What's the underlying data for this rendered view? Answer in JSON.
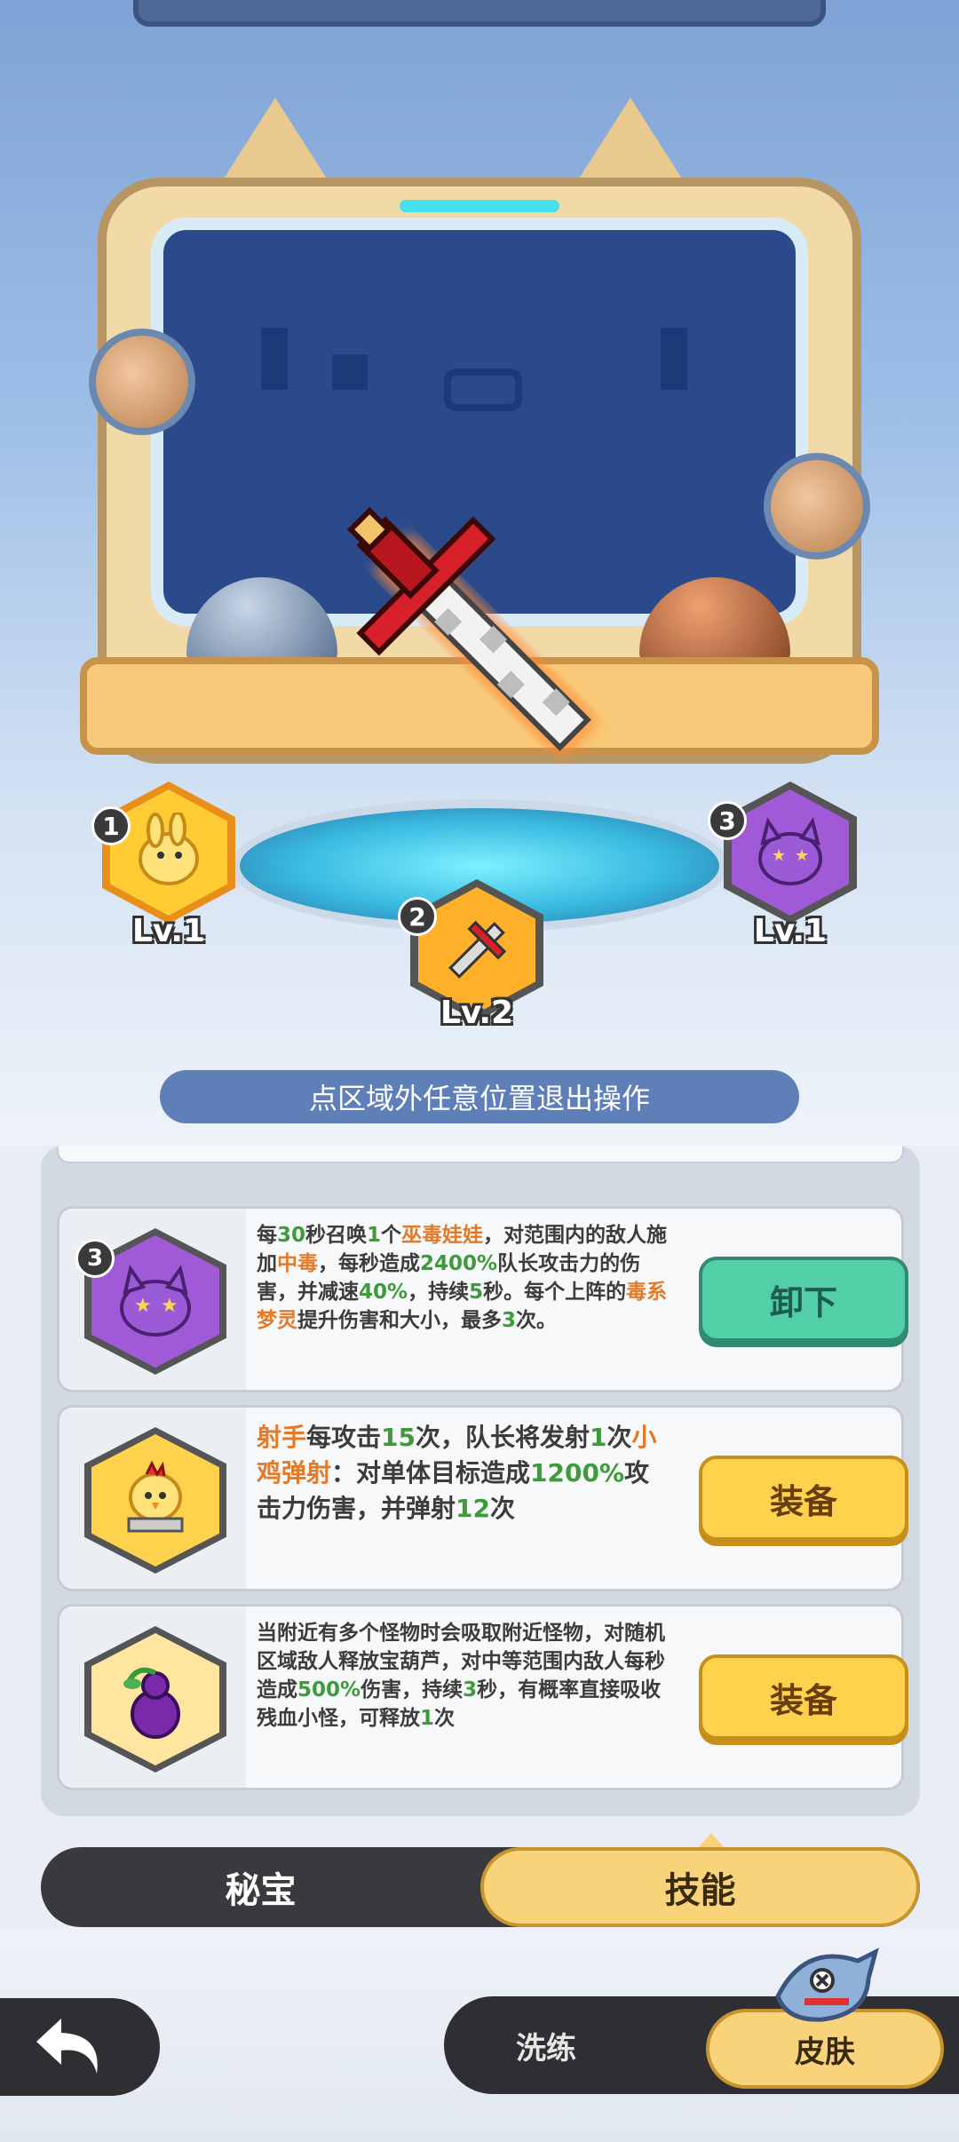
{
  "scene": {
    "featured_item_icon": "pixel-sword-icon",
    "slots": [
      {
        "number": "1",
        "level": "Lv.1",
        "icon": "chick-pet-icon",
        "color": "#ffcc33"
      },
      {
        "number": "2",
        "level": "Lv.2",
        "icon": "sword-icon",
        "color": "#ff8a2a"
      },
      {
        "number": "3",
        "level": "Lv.1",
        "icon": "purple-spirit-icon",
        "color": "#a05ad8"
      }
    ],
    "hint": "点区域外任意位置退出操作"
  },
  "skills": [
    {
      "number": "3",
      "icon": "poison-spirit-icon",
      "desc_html_parts": [
        {
          "t": "每",
          "c": ""
        },
        {
          "t": "30",
          "c": "g"
        },
        {
          "t": "秒召唤",
          "c": ""
        },
        {
          "t": "1",
          "c": "g"
        },
        {
          "t": "个",
          "c": ""
        },
        {
          "t": "巫毒娃娃",
          "c": "o"
        },
        {
          "t": "，对范围内的敌人施加",
          "c": ""
        },
        {
          "t": "中毒",
          "c": "o"
        },
        {
          "t": "，每秒造成",
          "c": ""
        },
        {
          "t": "2400%",
          "c": "g"
        },
        {
          "t": "队长攻击力的伤害，并减速",
          "c": ""
        },
        {
          "t": "40%",
          "c": "g"
        },
        {
          "t": "，持续",
          "c": ""
        },
        {
          "t": "5",
          "c": "g"
        },
        {
          "t": "秒。每个上阵的",
          "c": ""
        },
        {
          "t": "毒系梦灵",
          "c": "o"
        },
        {
          "t": "提升伤害和大小，最多",
          "c": ""
        },
        {
          "t": "3",
          "c": "g"
        },
        {
          "t": "次。",
          "c": ""
        }
      ],
      "button": "卸下",
      "button_type": "unequip"
    },
    {
      "number": "",
      "icon": "chick-missile-icon",
      "desc_html_parts": [
        {
          "t": "射手",
          "c": "o"
        },
        {
          "t": "每攻击",
          "c": ""
        },
        {
          "t": "15",
          "c": "g"
        },
        {
          "t": "次，队长将发射",
          "c": ""
        },
        {
          "t": "1",
          "c": "g"
        },
        {
          "t": "次",
          "c": ""
        },
        {
          "t": "小鸡弹射",
          "c": "o"
        },
        {
          "t": "：对单体目标造成",
          "c": ""
        },
        {
          "t": "1200%",
          "c": "g"
        },
        {
          "t": "攻击力伤害，并弹射",
          "c": ""
        },
        {
          "t": "12",
          "c": "g"
        },
        {
          "t": "次",
          "c": ""
        }
      ],
      "button": "装备",
      "button_type": "equip",
      "big": true
    },
    {
      "number": "",
      "icon": "treasure-gourd-icon",
      "desc_html_parts": [
        {
          "t": "当附近有多个怪物时会吸取附近怪物，对随机区域敌人释放宝葫芦，对中等范围内敌人每秒造成",
          "c": ""
        },
        {
          "t": "500%",
          "c": "g"
        },
        {
          "t": "伤害，持续",
          "c": ""
        },
        {
          "t": "3",
          "c": "g"
        },
        {
          "t": "秒，有概率直接吸收残血小怪，可释放",
          "c": ""
        },
        {
          "t": "1",
          "c": "g"
        },
        {
          "t": "次",
          "c": ""
        }
      ],
      "button": "装备",
      "button_type": "equip"
    }
  ],
  "tabs": {
    "treasure": "秘宝",
    "skill": "技能",
    "active": "skill"
  },
  "bottom": {
    "refine": "洗练",
    "skin": "皮肤",
    "back_icon": "back-arrow-icon"
  },
  "colors": {
    "highlight_orange": "#e27a2a",
    "highlight_green": "#3e9b3a",
    "equip_yellow": "#ffd24d",
    "unequip_green": "#52cfa6"
  }
}
